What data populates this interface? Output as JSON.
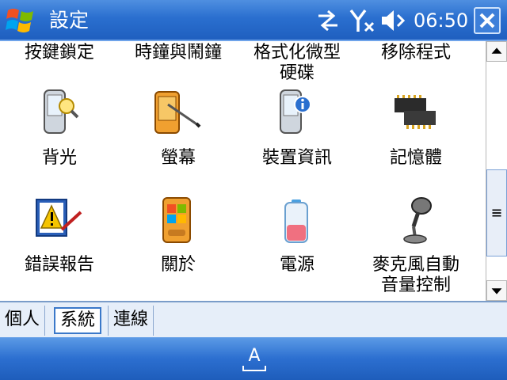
{
  "title_bar": {
    "title": "設定",
    "clock": "06:50",
    "icons": [
      "windows-start-icon",
      "sync-arrows-icon",
      "signal-off-icon",
      "speaker-icon",
      "close-icon"
    ]
  },
  "items": [
    {
      "label_lines": [
        "按鍵鎖定"
      ],
      "icon": "keylock-icon"
    },
    {
      "label_lines": [
        "時鐘與鬧鐘"
      ],
      "icon": "clock-alarm-icon"
    },
    {
      "label_lines": [
        "格式化微型",
        "硬碟"
      ],
      "icon": "format-drive-icon"
    },
    {
      "label_lines": [
        "移除程式"
      ],
      "icon": "remove-programs-icon"
    },
    {
      "label_lines": [
        "背光"
      ],
      "icon": "backlight-icon"
    },
    {
      "label_lines": [
        "螢幕"
      ],
      "icon": "screen-icon"
    },
    {
      "label_lines": [
        "裝置資訊"
      ],
      "icon": "device-info-icon"
    },
    {
      "label_lines": [
        "記憶體"
      ],
      "icon": "memory-chip-icon"
    },
    {
      "label_lines": [
        "錯誤報告"
      ],
      "icon": "error-report-icon"
    },
    {
      "label_lines": [
        "關於"
      ],
      "icon": "about-icon"
    },
    {
      "label_lines": [
        "電源"
      ],
      "icon": "battery-icon"
    },
    {
      "label_lines": [
        "麥克風自動",
        "音量控制"
      ],
      "icon": "microphone-icon"
    }
  ],
  "tabs": [
    {
      "label": "個人",
      "active": false
    },
    {
      "label": "系統",
      "active": true
    },
    {
      "label": "連線",
      "active": false
    }
  ],
  "softkey": {
    "input_label": "A",
    "icon": "keyboard-input-icon"
  },
  "colors": {
    "title_bar": "#2a6fcf",
    "softkey_bar": "#2c6fd0",
    "tab_active_border": "#3a78c9"
  }
}
